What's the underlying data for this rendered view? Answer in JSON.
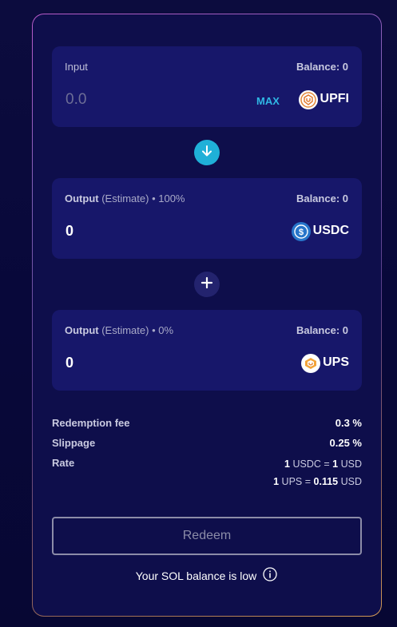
{
  "input_card": {
    "label": "Input",
    "balance": "Balance: 0",
    "amount_placeholder": "0.0",
    "max_label": "MAX",
    "token": "UPFI"
  },
  "output_card_1": {
    "label_strong": "Output",
    "label_muted": "(Estimate)",
    "label_suffix": "• 100%",
    "balance": "Balance: 0",
    "amount": "0",
    "token": "USDC"
  },
  "output_card_2": {
    "label_strong": "Output",
    "label_muted": "(Estimate)",
    "label_suffix": "• 0%",
    "balance": "Balance: 0",
    "amount": "0",
    "token": "UPS"
  },
  "details": {
    "redemption_fee_label": "Redemption fee",
    "redemption_fee_value": "0.3 %",
    "slippage_label": "Slippage",
    "slippage_value": "0.25 %",
    "rate_label": "Rate",
    "rate_line_1_a": "1",
    "rate_line_1_b": "USDC =",
    "rate_line_1_c": "1",
    "rate_line_1_d": "USD",
    "rate_line_2_a": "1",
    "rate_line_2_b": "UPS =",
    "rate_line_2_c": "0.115",
    "rate_line_2_d": "USD"
  },
  "redeem_button": "Redeem",
  "warning_text": "Your SOL balance is low",
  "colors": {
    "accent_cyan": "#1fb0d8",
    "max_blue": "#2fb7e4",
    "card_bg": "#17176a"
  },
  "icons": {
    "swap_arrow": "arrow-down-icon",
    "plus": "plus-icon",
    "info": "info-icon"
  }
}
